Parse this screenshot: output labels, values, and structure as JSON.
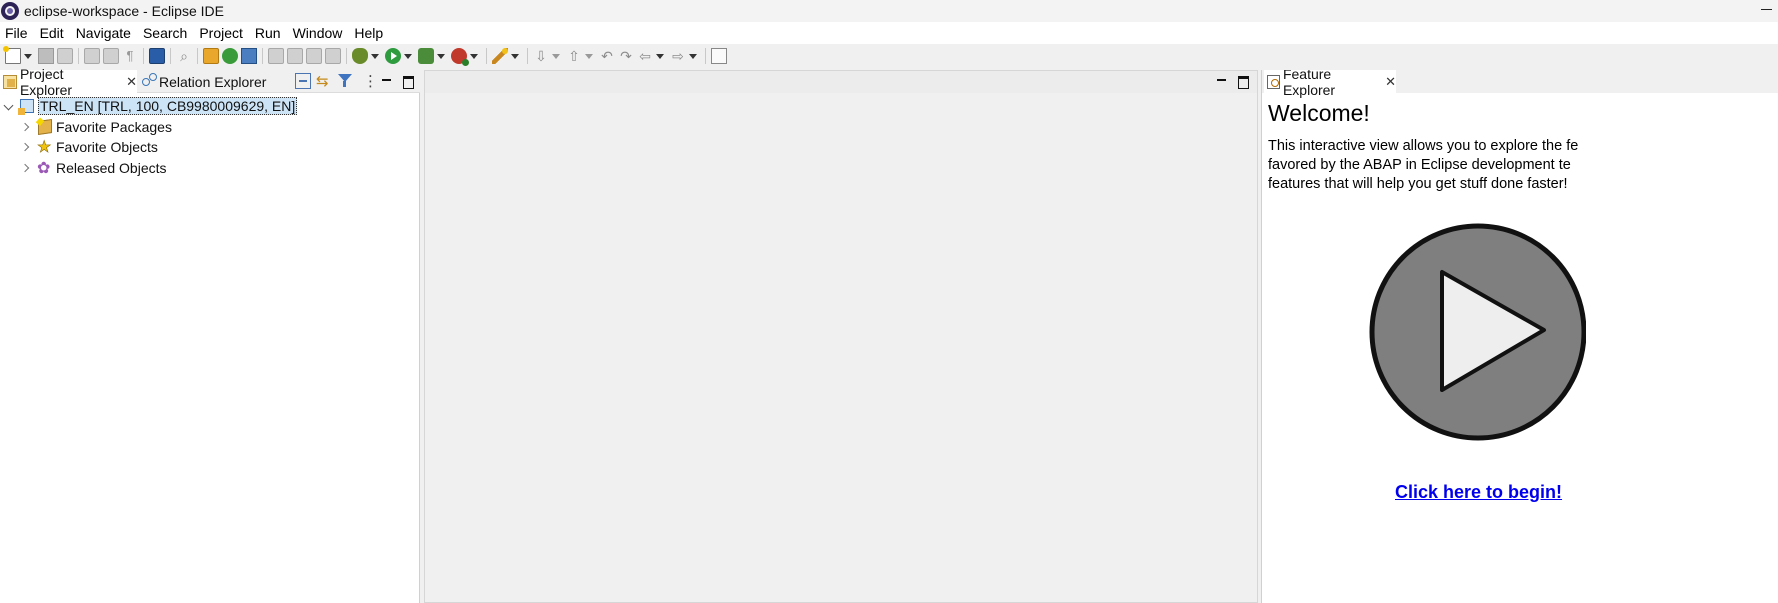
{
  "window": {
    "title": "eclipse-workspace - Eclipse IDE"
  },
  "menu": {
    "items": [
      {
        "label": "File"
      },
      {
        "label": "Edit"
      },
      {
        "label": "Navigate"
      },
      {
        "label": "Search"
      },
      {
        "label": "Project"
      },
      {
        "label": "Run"
      },
      {
        "label": "Window"
      },
      {
        "label": "Help"
      }
    ]
  },
  "toolbar": {
    "icons": [
      "new-icon",
      "save-icon",
      "save-all-icon",
      "open-type-icon",
      "pilcrow-icon",
      "terminal-icon",
      "search-icon",
      "open-abap-icon",
      "run-abap-icon",
      "abap-unit-icon",
      "transport-icon",
      "debug-icon",
      "run-icon",
      "coverage-icon",
      "external-tools-icon",
      "wand-icon",
      "next-annotation-icon",
      "prev-annotation-icon",
      "back-icon",
      "forward-icon",
      "pin-icon"
    ]
  },
  "left_pane": {
    "tabs": [
      {
        "label": "Project Explorer",
        "icon": "project-explorer-icon",
        "active": true
      },
      {
        "label": "Relation Explorer",
        "icon": "relation-explorer-icon",
        "active": false
      }
    ],
    "tree": {
      "root": {
        "label": "TRL_EN [TRL, 100, CB9980009629, EN]",
        "icon": "abap-project-icon",
        "expanded": true,
        "selected": true
      },
      "children": [
        {
          "label": "Favorite Packages",
          "icon": "favorite-packages-icon"
        },
        {
          "label": "Favorite Objects",
          "icon": "star-icon"
        },
        {
          "label": "Released Objects",
          "icon": "gear-icon"
        }
      ]
    }
  },
  "right_pane": {
    "tab": {
      "label": "Feature Explorer",
      "icon": "feature-explorer-icon"
    },
    "heading": "Welcome!",
    "intro_lines": [
      "This interactive view allows you to explore the fe",
      "favored by the ABAP in Eclipse development te",
      "features that will help you get stuff done faster!"
    ],
    "link": "Click here to begin!",
    "colors": {
      "link": "#0000ee",
      "play_fill": "#7f7f7f"
    }
  },
  "colors": {
    "selection": "#cde4f7",
    "background": "#f0f0f0"
  }
}
